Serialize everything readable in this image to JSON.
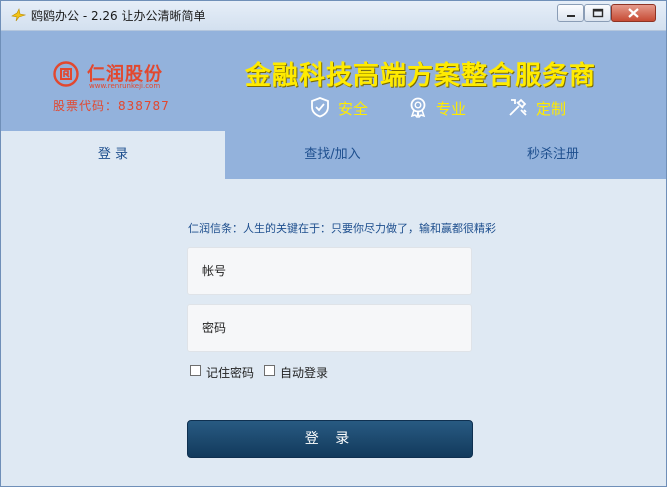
{
  "window": {
    "title": "鸥鸥办公 - 2.26 让办公清晰简单",
    "controls": [
      "minimize",
      "maximize",
      "close"
    ]
  },
  "header": {
    "company_name": "仁润股份",
    "company_url": "www.renrunkeji.com",
    "stock_code": "股票代码：838787",
    "slogan": "金融科技高端方案整合服务商",
    "features": [
      {
        "label": "安全",
        "icon": "shield-check-icon"
      },
      {
        "label": "专业",
        "icon": "award-medal-icon"
      },
      {
        "label": "定制",
        "icon": "tools-icon"
      }
    ],
    "colors": {
      "banner_bg": "#93b2dc",
      "slogan": "#ffeb00",
      "brand": "#e2482f"
    }
  },
  "tabs": [
    {
      "label": "登 录",
      "active": true
    },
    {
      "label": "查找/加入",
      "active": false
    },
    {
      "label": "秒杀注册",
      "active": false
    }
  ],
  "login": {
    "motto": "仁润信条：人生的关键在于：只要你尽力做了，输和赢都很精彩",
    "account_placeholder": "帐号",
    "password_placeholder": "密码",
    "remember_label": "记住密码",
    "auto_login_label": "自动登录",
    "remember_checked": false,
    "auto_login_checked": false,
    "submit_label": "登 录"
  }
}
